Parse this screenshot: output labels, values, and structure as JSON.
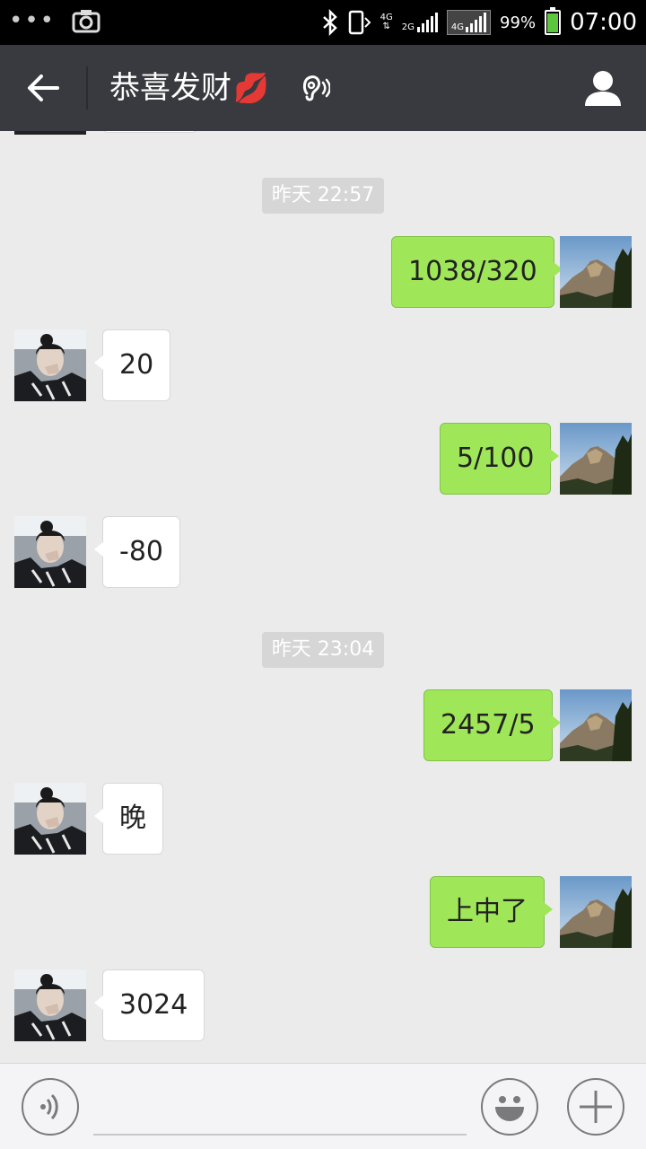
{
  "status_bar": {
    "overflow_icon": "overflow-dots-icon",
    "screenshot_icon": "camera-icon",
    "bluetooth_icon": "bluetooth-icon",
    "network_top": "4G",
    "network_bottom": "2G",
    "lte_label": "4G",
    "battery_percent": "99%",
    "battery_level": 0.99,
    "time": "07:00"
  },
  "header": {
    "back_icon": "arrow-left-icon",
    "title": "恭喜发财",
    "title_emoji": "💋",
    "earpiece_icon": "earpiece-mode-icon",
    "profile_icon": "person-icon",
    "background": "#393a3f"
  },
  "chat": {
    "outgoing_color": "#9fe758",
    "incoming_color": "#ffffff",
    "timestamps": [
      "昨天 22:57",
      "昨天 23:04"
    ],
    "messages": [
      {
        "dir": "out",
        "text": "1038/320"
      },
      {
        "dir": "in",
        "text": "20"
      },
      {
        "dir": "out",
        "text": "5/100"
      },
      {
        "dir": "in",
        "text": "-80"
      },
      {
        "dir": "out",
        "text": "2457/5"
      },
      {
        "dir": "in",
        "text": "晚"
      },
      {
        "dir": "out",
        "text": "上中了"
      },
      {
        "dir": "in",
        "text": "3024"
      }
    ]
  },
  "input_bar": {
    "voice_icon": "voice-input-icon",
    "text_value": "",
    "emoji_icon": "smiley-icon",
    "plus_icon": "plus-icon"
  }
}
